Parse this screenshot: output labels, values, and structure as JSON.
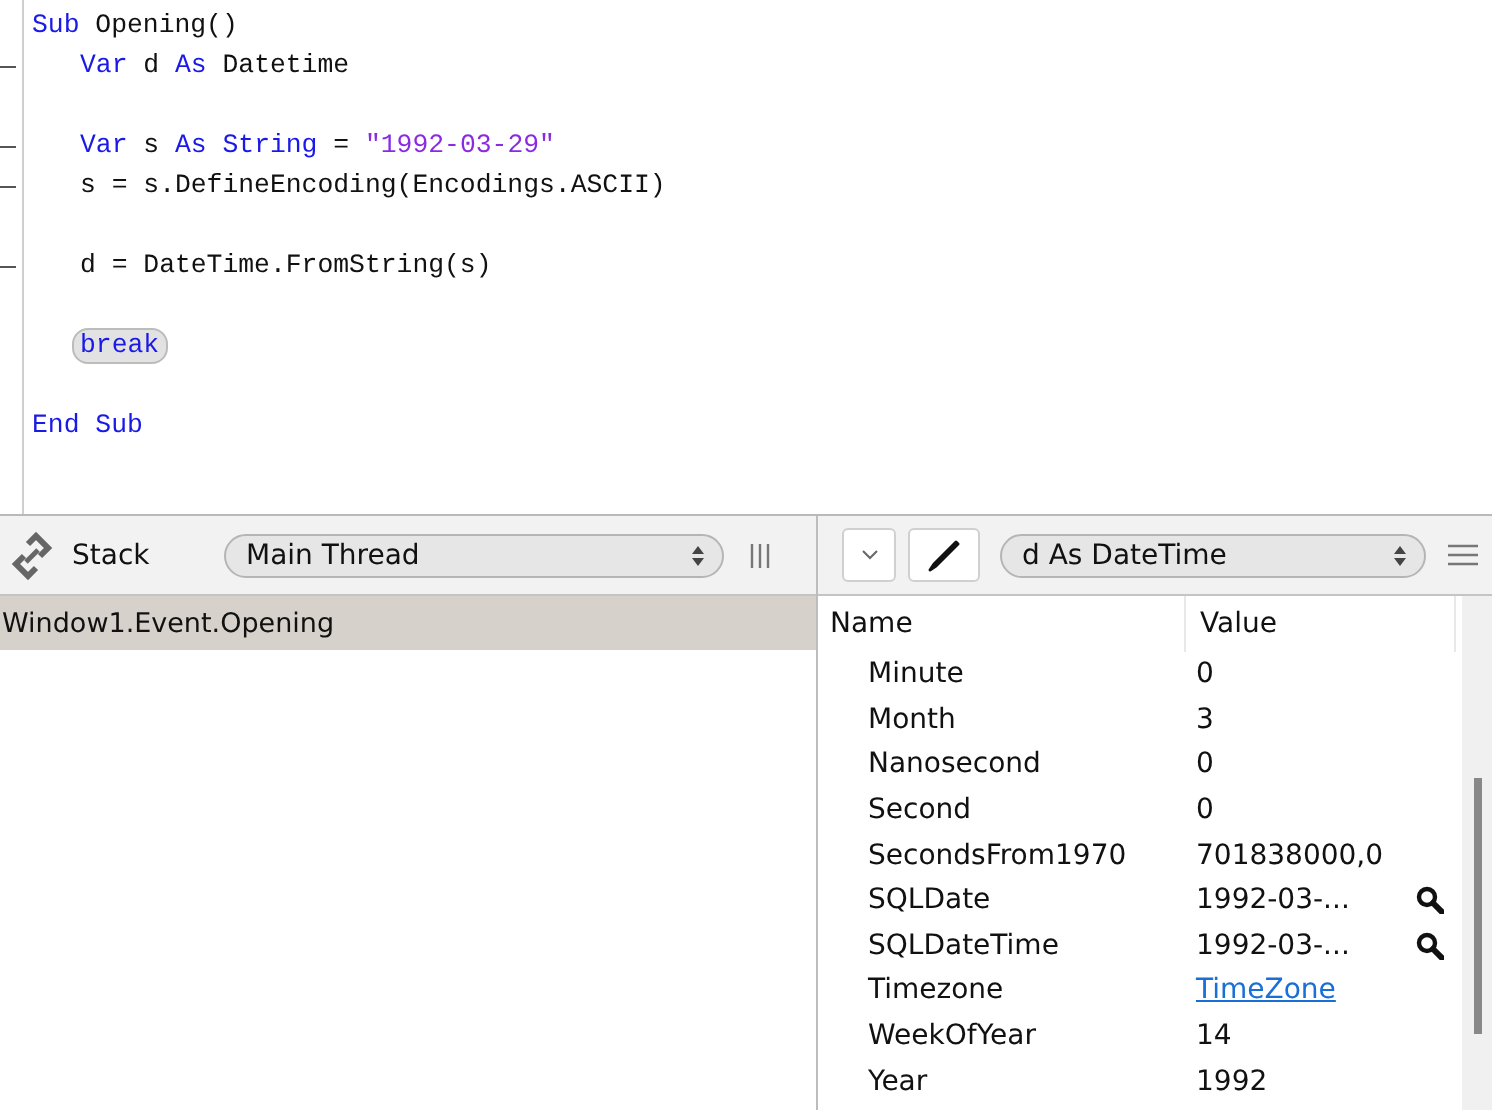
{
  "editor": {
    "lines": [
      {
        "kind": "code",
        "marker": false,
        "tokens": [
          {
            "kind": "keyword",
            "text": "Sub"
          },
          {
            "kind": "plain",
            "text": " Opening()"
          }
        ],
        "children": [
          {
            "kind": "code",
            "marker": true,
            "tokens": [
              {
                "kind": "keyword",
                "text": "Var"
              },
              {
                "kind": "plain",
                "text": " d "
              },
              {
                "kind": "keyword",
                "text": "As"
              },
              {
                "kind": "plain",
                "text": " Datetime"
              }
            ]
          },
          {
            "kind": "blank",
            "marker": false
          },
          {
            "kind": "code",
            "marker": true,
            "tokens": [
              {
                "kind": "keyword",
                "text": "Var"
              },
              {
                "kind": "plain",
                "text": " s "
              },
              {
                "kind": "keyword",
                "text": "As String"
              },
              {
                "kind": "plain",
                "text": " = "
              },
              {
                "kind": "string",
                "text": "\"1992-03-29\""
              }
            ]
          },
          {
            "kind": "code",
            "marker": true,
            "tokens": [
              {
                "kind": "plain",
                "text": "s = s.DefineEncoding(Encodings.ASCII)"
              }
            ]
          },
          {
            "kind": "blank",
            "marker": false
          },
          {
            "kind": "code",
            "marker": true,
            "tokens": [
              {
                "kind": "plain",
                "text": "d = DateTime.FromString(s)"
              }
            ]
          },
          {
            "kind": "blank",
            "marker": false
          },
          {
            "kind": "break",
            "marker": false,
            "tokens": [
              {
                "kind": "keyword",
                "text": "break"
              }
            ]
          },
          {
            "kind": "blank",
            "marker": false
          }
        ]
      },
      {
        "kind": "code",
        "marker": false,
        "tokens": [
          {
            "kind": "keyword",
            "text": "End Sub"
          }
        ]
      }
    ]
  },
  "stack_pane": {
    "title": "Stack",
    "thread_select": "Main Thread",
    "frames": [
      {
        "label": "Window1.Event.Opening",
        "selected": true
      }
    ]
  },
  "variables_pane": {
    "variable_select": "d As DateTime",
    "columns": [
      "Name",
      "Value"
    ],
    "rows": [
      {
        "name": "Minute",
        "value": "0",
        "kind": "plain"
      },
      {
        "name": "Month",
        "value": "3",
        "kind": "plain"
      },
      {
        "name": "Nanosecond",
        "value": "0",
        "kind": "plain"
      },
      {
        "name": "Second",
        "value": "0",
        "kind": "plain"
      },
      {
        "name": "SecondsFrom1970",
        "value": "701838000,0",
        "kind": "plain"
      },
      {
        "name": "SQLDate",
        "value": "1992-03-...",
        "kind": "inspect"
      },
      {
        "name": "SQLDateTime",
        "value": "1992-03-...",
        "kind": "inspect"
      },
      {
        "name": "Timezone",
        "value": "TimeZone",
        "kind": "link"
      },
      {
        "name": "WeekOfYear",
        "value": "14",
        "kind": "plain"
      },
      {
        "name": "Year",
        "value": "1992",
        "kind": "plain"
      }
    ]
  }
}
